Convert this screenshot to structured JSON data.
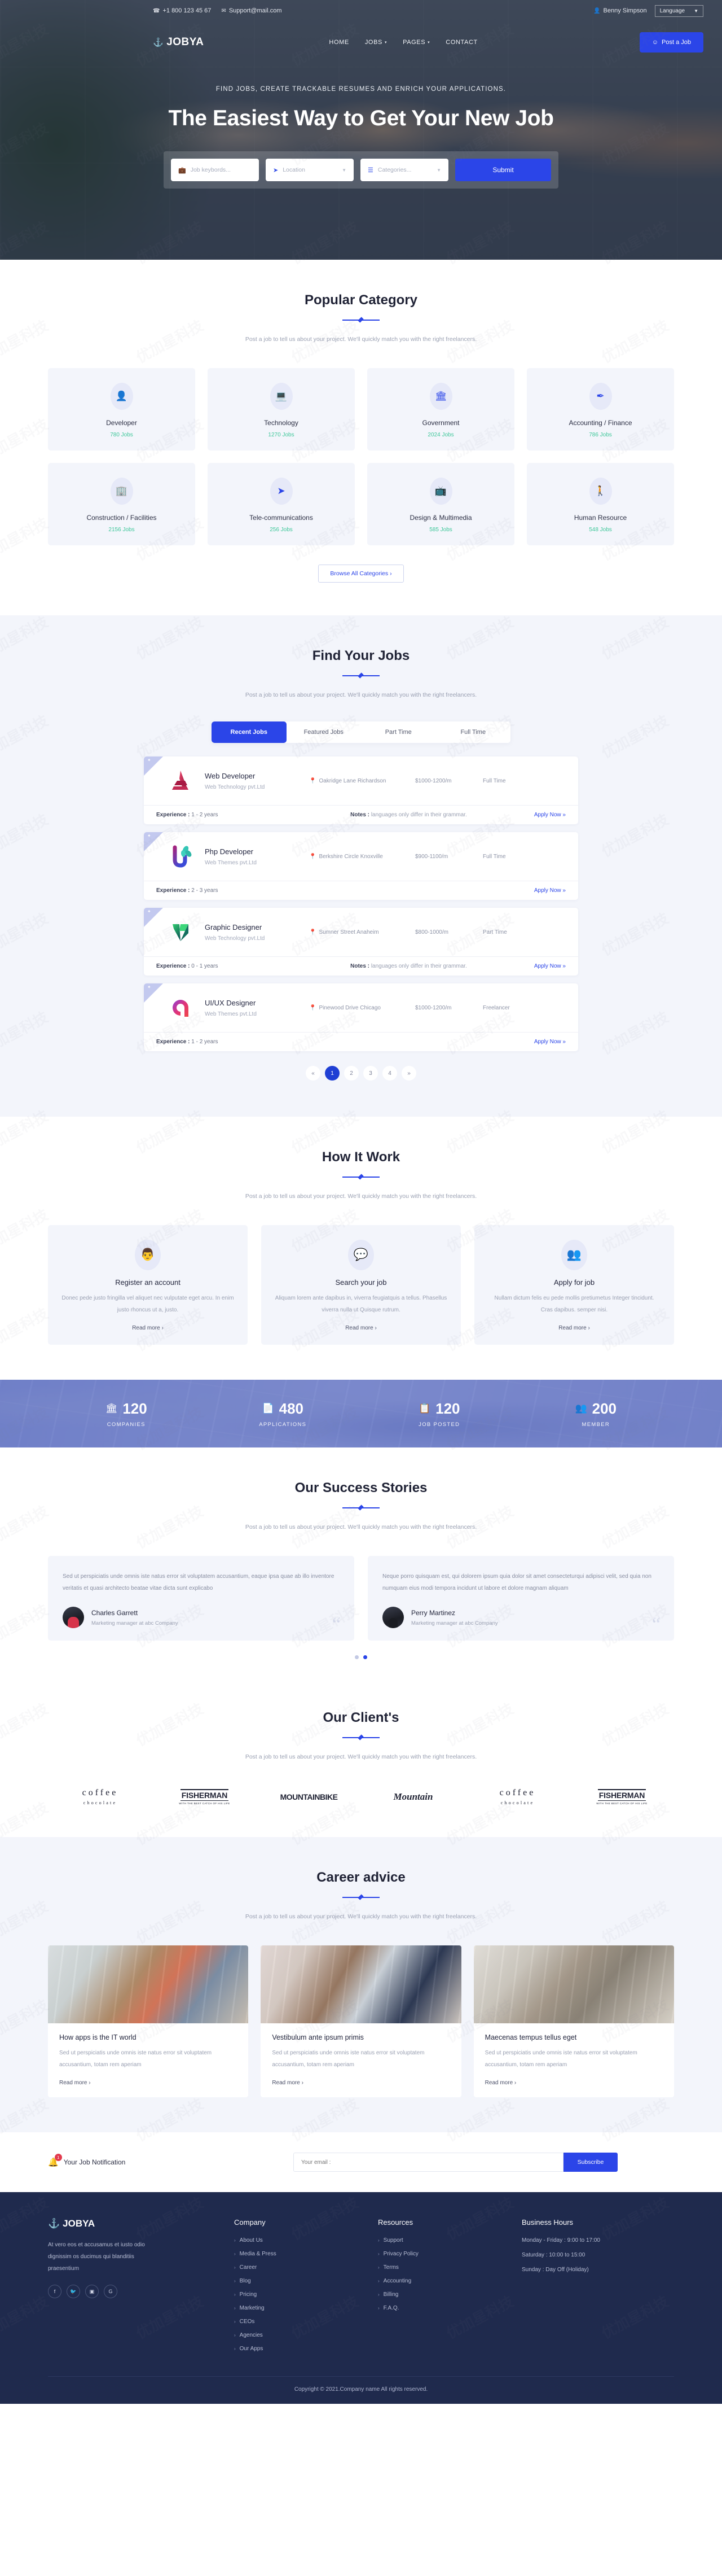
{
  "topbar": {
    "phone": "+1 800 123 45 67",
    "email": "Support@mail.com",
    "user": "Benny Simpson",
    "language": "Language",
    "phone_icon": "phone-icon",
    "mail_icon": "mail-icon",
    "user_icon": "user-icon"
  },
  "nav": {
    "brand": "JOBYA",
    "items": [
      {
        "label": "HOME",
        "caret": ""
      },
      {
        "label": "JOBS",
        "caret": "▾"
      },
      {
        "label": "PAGES",
        "caret": "▾"
      },
      {
        "label": "CONTACT",
        "caret": ""
      }
    ],
    "post_job": "Post a Job"
  },
  "hero": {
    "subtitle": "FIND JOBS, CREATE TRACKABLE RESUMES AND ENRICH YOUR APPLICATIONS.",
    "title": "The Easiest Way to Get Your New Job",
    "search": {
      "keywords_placeholder": "Job keybords...",
      "location_placeholder": "Location",
      "categories_placeholder": "Categories...",
      "submit": "Submit"
    }
  },
  "common": {
    "section_desc": "Post a job to tell us about your project. We'll quickly match you with the right freelancers."
  },
  "category": {
    "title": "Popular Category",
    "browse_all": "Browse All Categories",
    "items": [
      {
        "name": "Developer",
        "jobs": "780 Jobs",
        "icon": "user-badge-icon",
        "glyph": "👤"
      },
      {
        "name": "Technology",
        "jobs": "1270 Jobs",
        "icon": "computer-icon",
        "glyph": "🖥"
      },
      {
        "name": "Government",
        "jobs": "2024 Jobs",
        "icon": "bank-icon",
        "glyph": "🏦"
      },
      {
        "name": "Accounting / Finance",
        "jobs": "786 Jobs",
        "icon": "magic-wand-icon",
        "glyph": "✒"
      },
      {
        "name": "Construction / Facilities",
        "jobs": "2156 Jobs",
        "icon": "building-icon",
        "glyph": "🏢"
      },
      {
        "name": "Tele-communications",
        "jobs": "256 Jobs",
        "icon": "paper-plane-icon",
        "glyph": "➤"
      },
      {
        "name": "Design & Multimedia",
        "jobs": "585 Jobs",
        "icon": "tv-icon",
        "glyph": "📺"
      },
      {
        "name": "Human Resource",
        "jobs": "548 Jobs",
        "icon": "person-icon",
        "glyph": "🚶"
      }
    ]
  },
  "jobs": {
    "title": "Find Your Jobs",
    "tabs": [
      {
        "label": "Recent Jobs",
        "active": true
      },
      {
        "label": "Featured Jobs",
        "active": false
      },
      {
        "label": "Part Time",
        "active": false
      },
      {
        "label": "Full Time",
        "active": false
      }
    ],
    "apply_label": "Apply Now »",
    "experience_label": "Experience :",
    "notes_label": "Notes :",
    "items": [
      {
        "title": "Web Developer",
        "company": "Web Technology pvt.Ltd",
        "location": "Oakridge Lane Richardson",
        "salary": "$1000-1200/m",
        "type": "Full Time",
        "experience": "1 - 2 years",
        "notes": "languages only differ in their grammar.",
        "logo": "logo-a-red"
      },
      {
        "title": "Php Developer",
        "company": "Web Themes pvt.Ltd",
        "location": "Berkshire Circle Knoxville",
        "salary": "$900-1100/m",
        "type": "Full Time",
        "experience": "2 - 3 years",
        "notes": "",
        "logo": "logo-u-leaf"
      },
      {
        "title": "Graphic Designer",
        "company": "Web Technology pvt.Ltd",
        "location": "Sumner Street Anaheim",
        "salary": "$800-1000/m",
        "type": "Part Time",
        "experience": "0 - 1 years",
        "notes": "languages only differ in their grammar.",
        "logo": "logo-v-green"
      },
      {
        "title": "UI/UX Designer",
        "company": "Web Themes pvt.Ltd",
        "location": "Pinewood Drive Chicago",
        "salary": "$1000-1200/m",
        "type": "Freelancer",
        "experience": "1 - 2 years",
        "notes": "",
        "logo": "logo-spiral-pink"
      }
    ],
    "pagination": {
      "prev": "«",
      "next": "»",
      "pages": [
        "1",
        "2",
        "3",
        "4"
      ],
      "current": "1"
    }
  },
  "how": {
    "title": "How It Work",
    "read_more": "Read more ›",
    "items": [
      {
        "title": "Register an account",
        "text": "Donec pede justo fringilla vel aliquet nec vulputate eget arcu. In enim justo rhoncus ut a, justo.",
        "icon": "speaker-person-icon",
        "glyph": "👨‍💼"
      },
      {
        "title": "Search your job",
        "text": "Aliquam lorem ante dapibus in, viverra feugiatquis a tellus. Phasellus viverra nulla ut Quisque rutrum.",
        "icon": "interview-icon",
        "glyph": "💬"
      },
      {
        "title": "Apply for job",
        "text": "Nullam dictum felis eu pede mollis pretiumetus Integer tincidunt. Cras dapibus. semper nisi.",
        "icon": "team-icon",
        "glyph": "👥"
      }
    ]
  },
  "counters": [
    {
      "value": "120",
      "label": "COMPANIES",
      "icon": "bank-icon",
      "glyph": "🏛"
    },
    {
      "value": "480",
      "label": "APPLICATIONS",
      "icon": "document-icon",
      "glyph": "📄"
    },
    {
      "value": "120",
      "label": "JOB POSTED",
      "icon": "clipboard-check-icon",
      "glyph": "📋"
    },
    {
      "value": "200",
      "label": "MEMBER",
      "icon": "add-user-icon",
      "glyph": "👥"
    }
  ],
  "testimonials": {
    "title": "Our Success Stories",
    "items": [
      {
        "text": "Sed ut perspiciatis unde omnis iste natus error sit voluptatem accusantium, eaque ipsa quae ab illo inventore veritatis et quasi architecto beatae vitae dicta sunt explicabo",
        "name": "Charles Garrett",
        "role": "Marketing manager at abc Company"
      },
      {
        "text": "Neque porro quisquam est, qui dolorem ipsum quia dolor sit amet consecteturqui adipisci velit, sed quia non numquam eius modi tempora incidunt ut labore et dolore magnam aliquam",
        "name": "Perry Martinez",
        "role": "Marketing manager at abc Company"
      }
    ],
    "dots": [
      {
        "active": false
      },
      {
        "active": true
      }
    ]
  },
  "clients": {
    "title": "Our Client's",
    "items": [
      {
        "kind": "coffee",
        "line1": "coffee",
        "line2": "chocolate"
      },
      {
        "kind": "fisherman",
        "line1": "FISHERMAN",
        "line2": "WITH THE BEST CATCH OF HIS LIFE"
      },
      {
        "kind": "mountainbike",
        "line1": "MOUNTAINBIKE",
        "line2": ""
      },
      {
        "kind": "mountain",
        "line1": "Mountain",
        "line2": ""
      },
      {
        "kind": "coffee",
        "line1": "coffee",
        "line2": "chocolate"
      },
      {
        "kind": "fisherman",
        "line1": "FISHERMAN",
        "line2": "WITH THE BEST CATCH OF HIS LIFE"
      }
    ]
  },
  "blog": {
    "title": "Career advice",
    "read_more": "Read more ›",
    "items": [
      {
        "title": "How apps is the IT world",
        "text": "Sed ut perspiciatis unde omnis iste natus error sit voluptatem accusantium, totam rem aperiam",
        "image": "office-desk-photo"
      },
      {
        "title": "Vestibulum ante ipsum primis",
        "text": "Sed ut perspiciatis unde omnis iste natus error sit voluptatem accusantium, totam rem aperiam",
        "image": "people-with-laptop-photo"
      },
      {
        "title": "Maecenas tempus tellus eget",
        "text": "Sed ut perspiciatis unde omnis iste natus error sit voluptatem accusantium, totam rem aperiam",
        "image": "waiting-room-photo"
      }
    ]
  },
  "newsletter": {
    "label": "Your Job Notification",
    "badge": "1",
    "placeholder": "Your email :",
    "button": "Subscribe"
  },
  "footer": {
    "brand": "JOBYA",
    "about": "At vero eos et accusamus et iusto odio dignissim os ducimus qui blanditiis praesentium",
    "social": [
      {
        "name": "facebook-icon",
        "glyph": "f"
      },
      {
        "name": "twitter-icon",
        "glyph": "🐦"
      },
      {
        "name": "instagram-icon",
        "glyph": "▣"
      },
      {
        "name": "google-icon",
        "glyph": "G"
      }
    ],
    "company": {
      "head": "Company",
      "items": [
        "About Us",
        "Media & Press",
        "Career",
        "Blog",
        "Pricing",
        "Marketing",
        "CEOs",
        "Agencies",
        "Our Apps"
      ]
    },
    "resources": {
      "head": "Resources",
      "items": [
        "Support",
        "Privacy Policy",
        "Terms",
        "Accounting",
        "Billing",
        "F.A.Q."
      ]
    },
    "hours": {
      "head": "Business Hours",
      "items": [
        "Monday - Friday : 9:00 to 17:00",
        "Saturday : 10:00 to 15:00",
        "Sunday : Day Off (Holiday)"
      ]
    },
    "copyright": "Copyright © 2021.Company name All rights reserved."
  },
  "colors": {
    "primary": "#2b45e8",
    "dark_navy": "#1f2a4d",
    "light_bg": "#f3f5fb",
    "green": "#3fc79a",
    "red_badge": "#e23b4e"
  }
}
